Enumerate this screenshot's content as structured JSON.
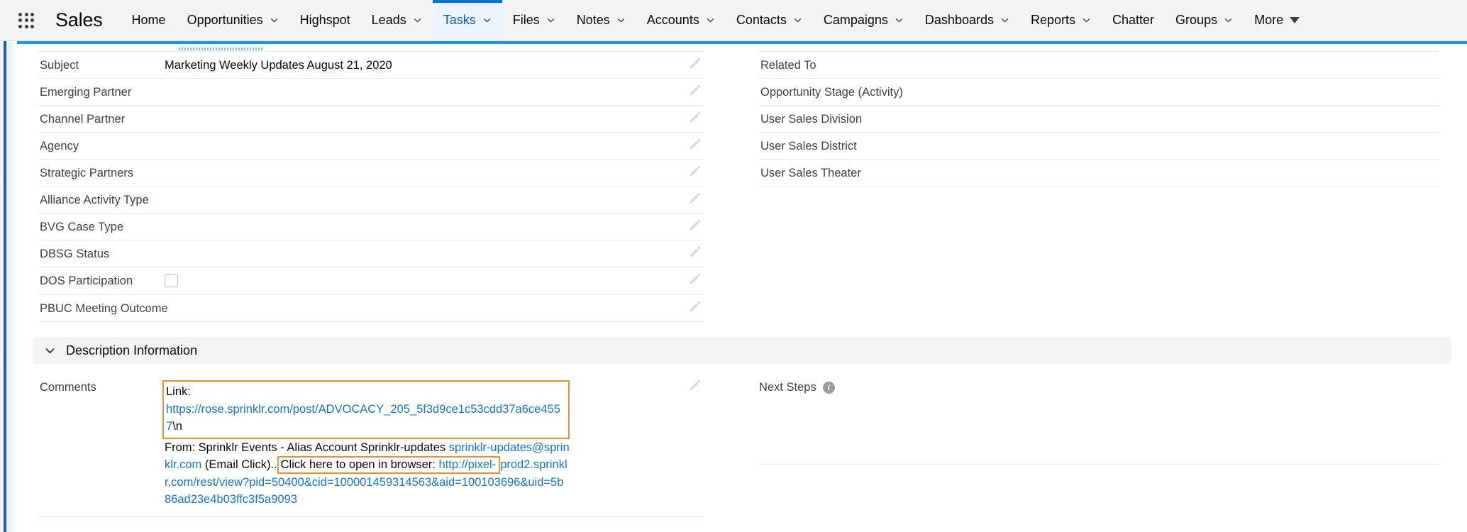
{
  "global_nav": {
    "app_launcher_icon": "app-launcher-waffle-icon",
    "app_name": "Sales",
    "items": [
      {
        "label": "Home",
        "has_menu": false,
        "active": false
      },
      {
        "label": "Opportunities",
        "has_menu": true,
        "active": false
      },
      {
        "label": "Highspot",
        "has_menu": false,
        "active": false
      },
      {
        "label": "Leads",
        "has_menu": true,
        "active": false
      },
      {
        "label": "Tasks",
        "has_menu": true,
        "active": true
      },
      {
        "label": "Files",
        "has_menu": true,
        "active": false
      },
      {
        "label": "Notes",
        "has_menu": true,
        "active": false
      },
      {
        "label": "Accounts",
        "has_menu": true,
        "active": false
      },
      {
        "label": "Contacts",
        "has_menu": true,
        "active": false
      },
      {
        "label": "Campaigns",
        "has_menu": true,
        "active": false
      },
      {
        "label": "Dashboards",
        "has_menu": true,
        "active": false
      },
      {
        "label": "Reports",
        "has_menu": true,
        "active": false
      },
      {
        "label": "Chatter",
        "has_menu": false,
        "active": false
      },
      {
        "label": "Groups",
        "has_menu": true,
        "active": false
      },
      {
        "label": "More",
        "has_menu": true,
        "active": false,
        "caret": true
      }
    ]
  },
  "record": {
    "left_fields": [
      {
        "label": "Subject",
        "value": "Marketing Weekly Updates August 21, 2020",
        "editable": true,
        "type": "text"
      },
      {
        "label": "Emerging Partner",
        "value": "",
        "editable": true,
        "type": "text"
      },
      {
        "label": "Channel Partner",
        "value": "",
        "editable": true,
        "type": "text"
      },
      {
        "label": "Agency",
        "value": "",
        "editable": true,
        "type": "text"
      },
      {
        "label": "Strategic Partners",
        "value": "",
        "editable": true,
        "type": "text"
      },
      {
        "label": "Alliance Activity Type",
        "value": "",
        "editable": true,
        "type": "text"
      },
      {
        "label": "BVG Case Type",
        "value": "",
        "editable": true,
        "type": "text"
      },
      {
        "label": "DBSG Status",
        "value": "",
        "editable": true,
        "type": "text"
      },
      {
        "label": "DOS Participation",
        "value": "",
        "editable": true,
        "type": "checkbox",
        "checked": false
      },
      {
        "label": "PBUC Meeting Outcome",
        "value": "",
        "editable": true,
        "type": "text"
      }
    ],
    "right_fields": [
      {
        "label": "Related To",
        "value": ""
      },
      {
        "label": "Opportunity Stage (Activity)",
        "value": ""
      },
      {
        "label": "User Sales Division",
        "value": ""
      },
      {
        "label": "User Sales District",
        "value": ""
      },
      {
        "label": "User Sales Theater",
        "value": ""
      }
    ]
  },
  "description_section": {
    "title": "Description Information",
    "twisty_icon": "chevron-down-icon",
    "expanded": true,
    "comments": {
      "label": "Comments",
      "line_link_label": "Link:",
      "link_url": "https://rose.sprinklr.com/post/ADVOCACY_205_5f3d9ce1c53cdd37a6ce4557",
      "link_suffix": "\\n",
      "from_prefix": "From: Sprinklr Events - Alias Account Sprinklr-updates ",
      "from_email": "sprinklr-updates@sprinklr.com",
      "email_click_text": "(Email Click)..",
      "click_here_text": "Click here to open in browser: ",
      "browser_url_part1": "http://pixel-",
      "browser_url_part2": "prod2.sprinklr.com/rest/view?",
      "browser_url_part3": "pid=50400&cid=100001459314563&aid=100103696&uid=5b86ad23e4b03ffc3f5a",
      "browser_url_part4": "9093"
    },
    "next_steps": {
      "label": "Next Steps",
      "info_icon": "info-icon",
      "info_glyph": "i",
      "value": ""
    }
  },
  "icons": {
    "edit_pencil": "edit-pencil-icon",
    "chevron_down": "chevron-down-icon",
    "checkbox": "checkbox-icon"
  },
  "colors": {
    "brand_blue": "#1b96e8",
    "active_tab_blue": "#0070d2",
    "link_blue": "#1673c6",
    "annotation_orange": "#f0902a",
    "label_gray": "#3e3e3c",
    "section_bg": "#f3f3f3"
  }
}
